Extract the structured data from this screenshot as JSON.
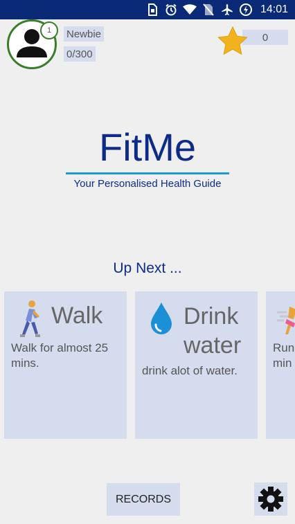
{
  "status_bar": {
    "time": "14:01",
    "icons": [
      "sim-icon",
      "alarm-icon",
      "wifi-icon",
      "no-sim-icon",
      "airplane-icon",
      "battery-charging-icon"
    ]
  },
  "profile": {
    "level": "1",
    "rank": "Newbie",
    "xp": "0/300",
    "points": "0"
  },
  "logo": {
    "title": "FitMe",
    "tagline": "Your Personalised Health Guide"
  },
  "up_next": {
    "heading": "Up Next ...",
    "cards": [
      {
        "title": "Walk",
        "description_lines": [
          "Walk for almost 25",
          "mins."
        ],
        "icon": "walking-person-icon"
      },
      {
        "title_lines": [
          "Drink",
          "water"
        ],
        "description": "drink alot of water.",
        "icon": "water-drop-icon"
      },
      {
        "description_lines": [
          "Run",
          "min"
        ],
        "icon": "running-icon"
      }
    ]
  },
  "bottom": {
    "records_label": "RECORDS",
    "settings_icon": "gear-icon"
  },
  "colors": {
    "status_bar": "#0a2a78",
    "brand": "#0e2b86",
    "accent_line": "#1a9bd1",
    "card": "#d5dced",
    "avatar_ring": "#3a7d2a",
    "star": "#f2b21b"
  }
}
